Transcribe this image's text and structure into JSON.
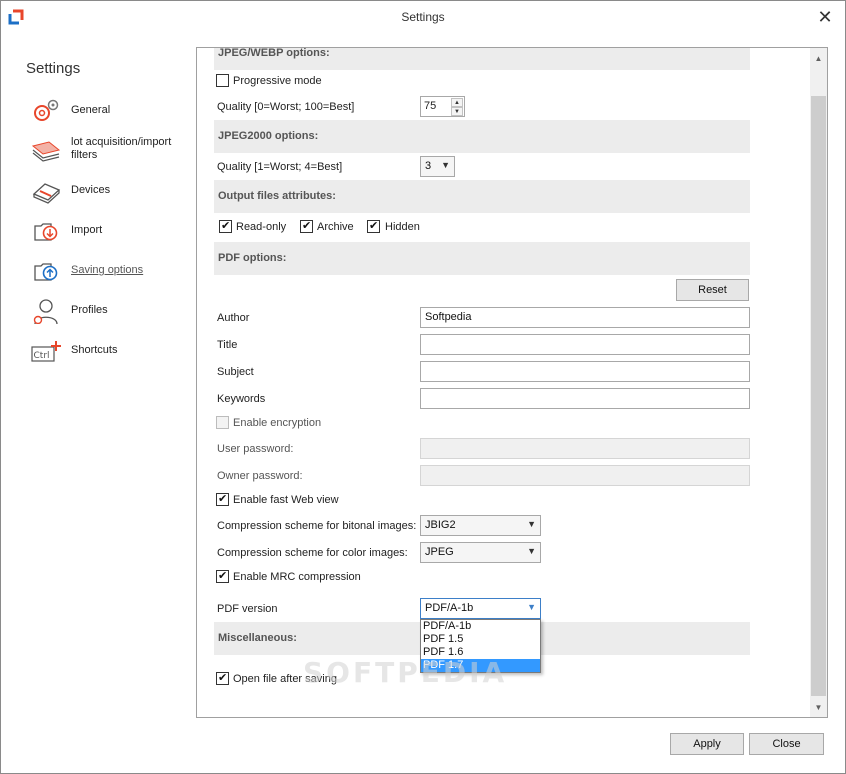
{
  "window": {
    "title": "Settings",
    "close_glyph": "✕",
    "app_icon": "app-logo-icon"
  },
  "sidebar": {
    "title": "Settings",
    "items": [
      {
        "label": "General",
        "icon": "gears-icon",
        "active": false
      },
      {
        "label": "lot acquisition/import filters",
        "icon": "paper-stack-icon",
        "active": false
      },
      {
        "label": "Devices",
        "icon": "scanner-icon",
        "active": false
      },
      {
        "label": "Import",
        "icon": "import-icon",
        "active": false
      },
      {
        "label": "Saving options",
        "icon": "saving-icon",
        "active": true
      },
      {
        "label": "Profiles",
        "icon": "profile-icon",
        "active": false
      },
      {
        "label": "Shortcuts",
        "icon": "ctrl-key-icon",
        "active": false
      }
    ]
  },
  "main": {
    "jpeg_webp": {
      "header": "JPEG/WEBP options:",
      "progressive_label": "Progressive mode",
      "progressive_checked": false,
      "quality_label": "Quality [0=Worst; 100=Best]",
      "quality_value": "75"
    },
    "jpeg2000": {
      "header": "JPEG2000 options:",
      "quality_label": "Quality [1=Worst; 4=Best]",
      "quality_value": "3"
    },
    "output_attrs": {
      "header": "Output files attributes:",
      "readonly_label": "Read-only",
      "archive_label": "Archive",
      "hidden_label": "Hidden"
    },
    "pdf": {
      "header": "PDF options:",
      "reset_label": "Reset",
      "author_label": "Author",
      "author_value": "Softpedia",
      "title_label": "Title",
      "title_value": "",
      "subject_label": "Subject",
      "subject_value": "",
      "keywords_label": "Keywords",
      "keywords_value": "",
      "encryption_label": "Enable encryption",
      "user_pw_label": "User password:",
      "owner_pw_label": "Owner password:",
      "fast_web_label": "Enable fast Web view",
      "bitonal_label": "Compression scheme for bitonal images:",
      "bitonal_value": "JBIG2",
      "color_label": "Compression scheme for color images:",
      "color_value": "JPEG",
      "mrc_label": "Enable MRC compression",
      "version_label": "PDF version",
      "version_value": "PDF/A-1b",
      "version_options": [
        "PDF/A-1b",
        "PDF 1.5",
        "PDF 1.6",
        "PDF 1.7"
      ],
      "version_highlighted": "PDF 1.7"
    },
    "misc": {
      "header": "Miscellaneous:",
      "open_after_label": "Open file after saving"
    }
  },
  "footer": {
    "apply_label": "Apply",
    "close_label": "Close"
  },
  "watermark": "SOFTPEDIA",
  "colors": {
    "accent_red": "#e8462b",
    "accent_blue": "#1c6fc6",
    "selection": "#3399ff"
  }
}
